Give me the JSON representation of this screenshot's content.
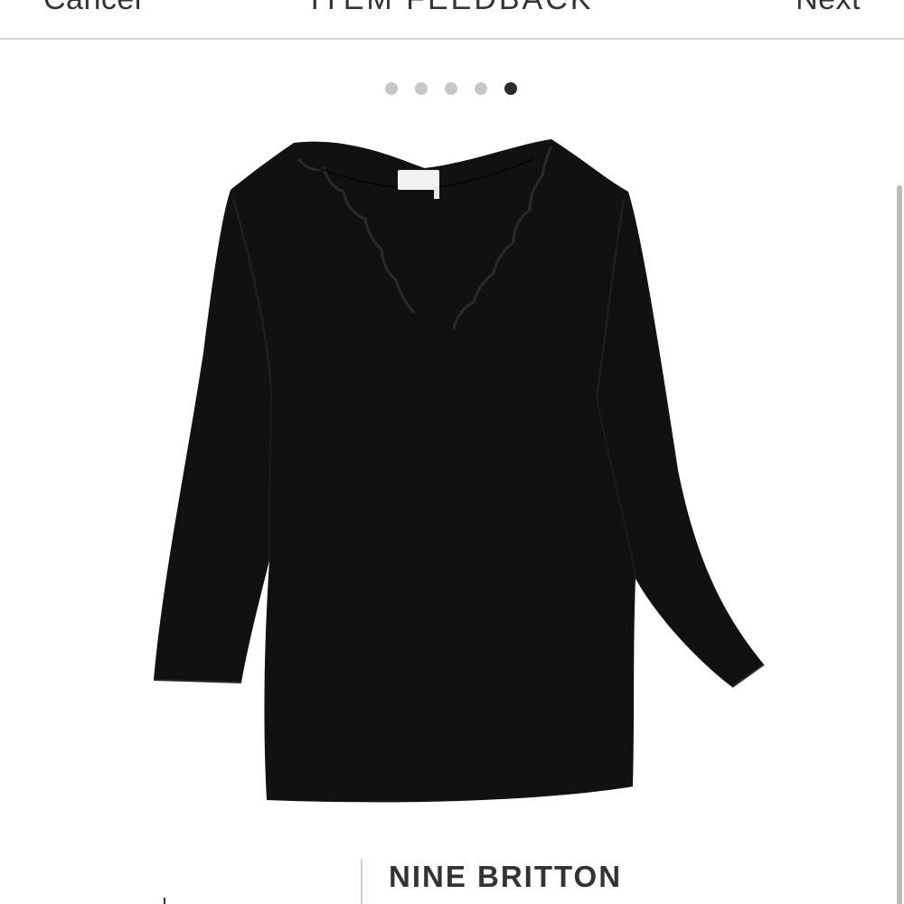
{
  "header": {
    "cancel_label": "Cancel",
    "title": "ITEM FEEDBACK",
    "next_label": "Next"
  },
  "carousel": {
    "total": 5,
    "active_index": 4
  },
  "product": {
    "brand": "NINE BRITTON"
  },
  "colors": {
    "garment": "#111111",
    "dot_inactive": "#c6c6c6",
    "dot_active": "#2a2a2a",
    "text": "#333333"
  }
}
